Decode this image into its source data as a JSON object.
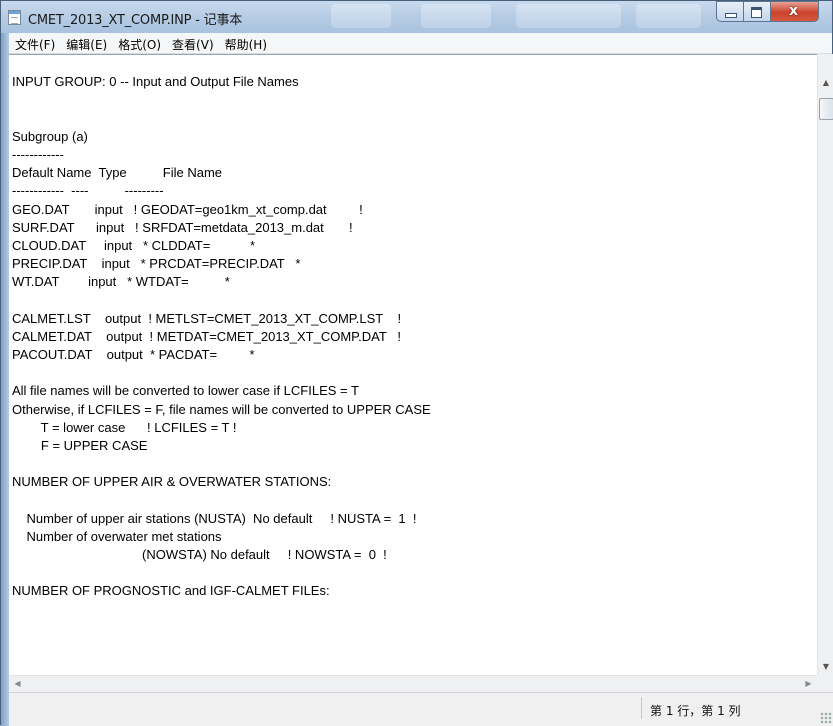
{
  "window": {
    "title": "CMET_2013_XT_COMP.INP - 记事本",
    "controls": {
      "minimize": "minimize",
      "maximize": "maximize",
      "close": "x"
    }
  },
  "menu": [
    "文件(F)",
    "编辑(E)",
    "格式(O)",
    "查看(V)",
    "帮助(H)"
  ],
  "document": {
    "lines": [
      "",
      "INPUT GROUP: 0 -- Input and Output File Names",
      "",
      "",
      "Subgroup (a)",
      "------------",
      "Default Name  Type          File Name",
      "------------  ----          ---------",
      "GEO.DAT       input   ! GEODAT=geo1km_xt_comp.dat         !",
      "SURF.DAT      input   ! SRFDAT=metdata_2013_m.dat       !",
      "CLOUD.DAT     input   * CLDDAT=           *",
      "PRECIP.DAT    input   * PRCDAT=PRECIP.DAT   *",
      "WT.DAT        input   * WTDAT=          *",
      "",
      "CALMET.LST    output  ! METLST=CMET_2013_XT_COMP.LST    !",
      "CALMET.DAT    output  ! METDAT=CMET_2013_XT_COMP.DAT   !",
      "PACOUT.DAT    output  * PACDAT=         *",
      "",
      "All file names will be converted to lower case if LCFILES = T",
      "Otherwise, if LCFILES = F, file names will be converted to UPPER CASE",
      "        T = lower case      ! LCFILES = T !",
      "        F = UPPER CASE",
      "",
      "NUMBER OF UPPER AIR & OVERWATER STATIONS:",
      "",
      "    Number of upper air stations (NUSTA)  No default     ! NUSTA =  1  !",
      "    Number of overwater met stations",
      "                                    (NOWSTA) No default     ! NOWSTA =  0  !",
      "",
      "NUMBER OF PROGNOSTIC and IGF-CALMET FILEs:",
      ""
    ]
  },
  "status": {
    "position": "第 1 行，第 1 列"
  }
}
